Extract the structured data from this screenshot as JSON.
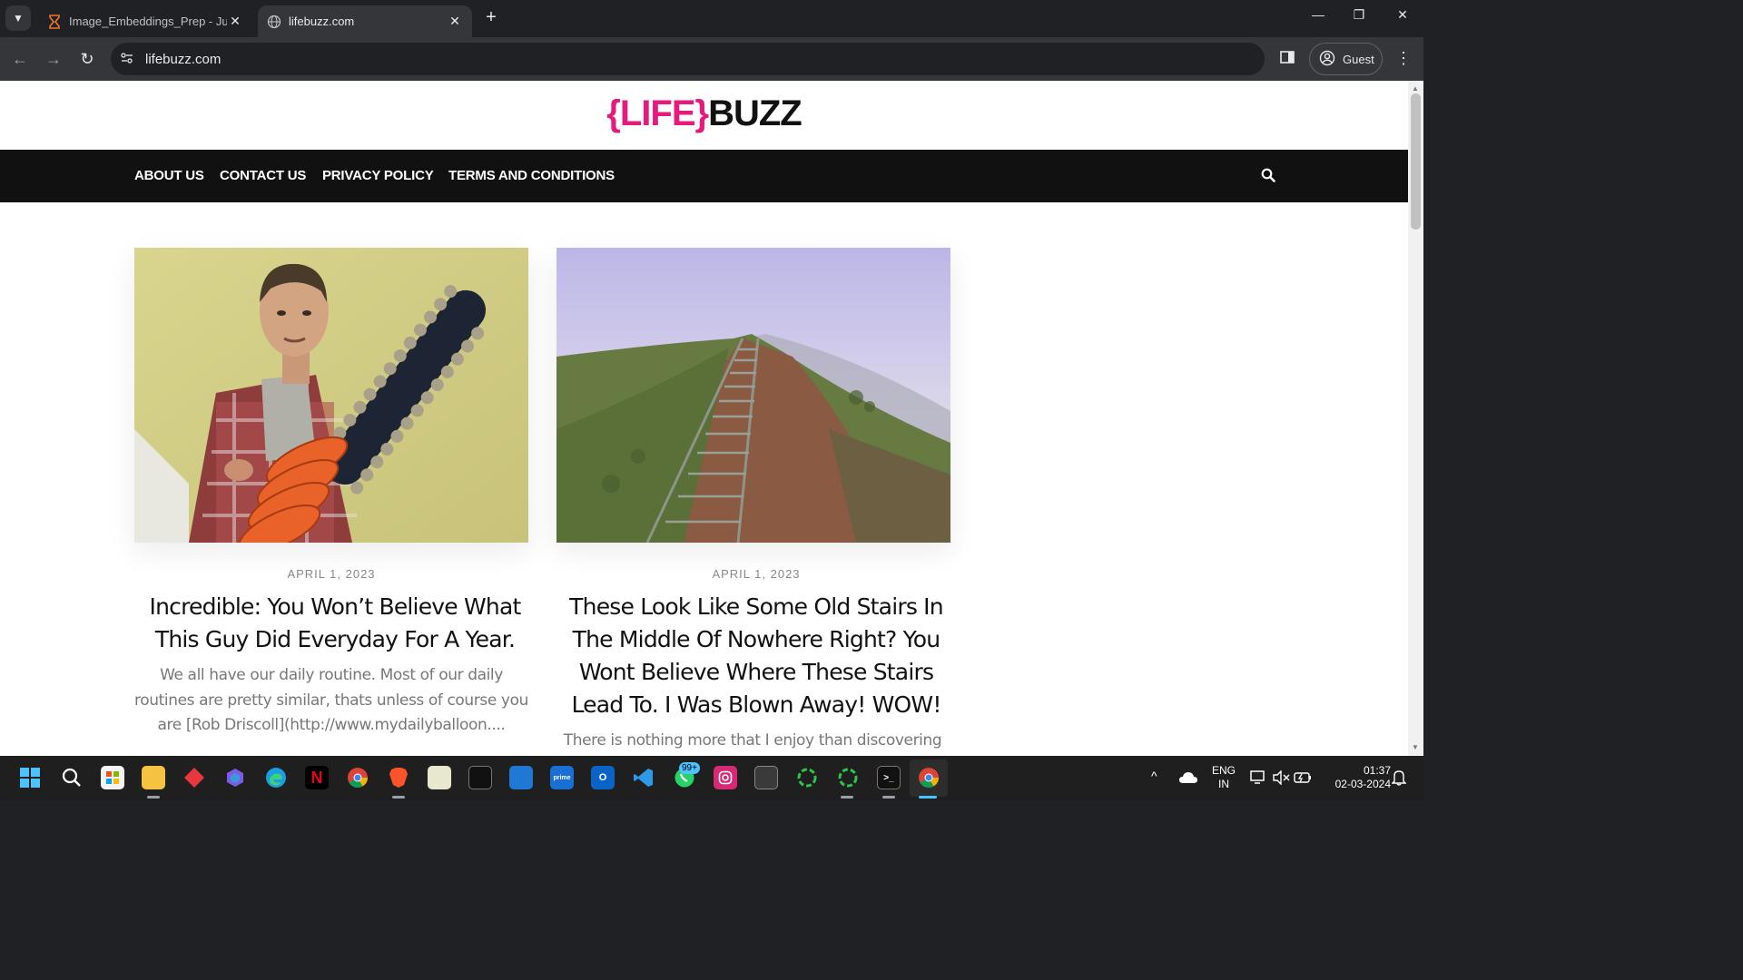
{
  "browser": {
    "tabs": [
      {
        "title": "Image_Embeddings_Prep - Jupyter",
        "active": false
      },
      {
        "title": "lifebuzz.com",
        "active": true
      }
    ],
    "address": "lifebuzz.com",
    "profile_label": "Guest"
  },
  "site": {
    "logo": {
      "brace_open": "{",
      "life": "LIFE",
      "brace_close": "}",
      "buzz": "BUZZ"
    },
    "nav": [
      "ABOUT US",
      "CONTACT US",
      "PRIVACY POLICY",
      "TERMS AND CONDITIONS"
    ],
    "posts": [
      {
        "date": "APRIL 1, 2023",
        "title_lines": [
          "Incredible: You Won’t Believe What",
          "This Guy Did Everyday For A Year."
        ],
        "excerpt_lines": [
          "We all have our daily routine. Most of our daily",
          "routines are pretty similar, thats unless of course you",
          "are [Rob Driscoll](http://www.mydailyballoon...."
        ]
      },
      {
        "date": "APRIL 1, 2023",
        "title_lines": [
          "These Look Like Some Old Stairs In",
          "The Middle Of Nowhere Right? You",
          "Wont Believe Where These Stairs",
          "Lead To. I Was Blown Away! WOW!"
        ],
        "excerpt_lines": [
          "There is nothing more that I enjoy than discovering"
        ]
      }
    ]
  },
  "taskbar": {
    "lang_top": "ENG",
    "lang_bottom": "IN",
    "time": "01:37",
    "date": "02-03-2024",
    "whatsapp_badge": "99+"
  },
  "colors": {
    "brand_pink": "#e6197c",
    "nav_bg": "#111111",
    "chrome_dark": "#202124",
    "chrome_toolbar": "#35363a"
  }
}
